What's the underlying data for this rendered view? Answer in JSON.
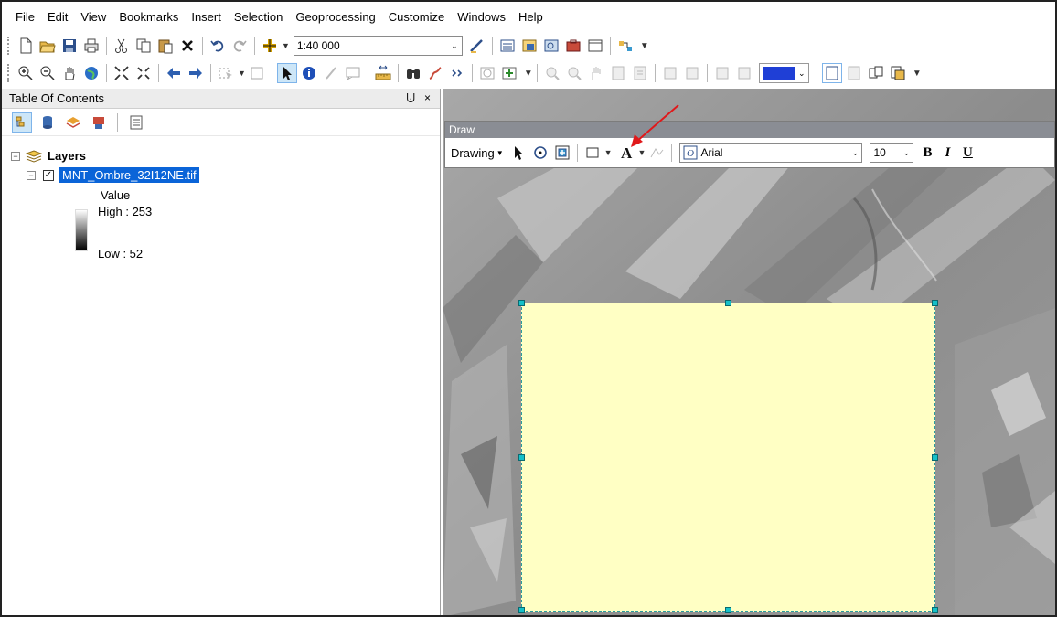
{
  "menu": [
    "File",
    "Edit",
    "View",
    "Bookmarks",
    "Insert",
    "Selection",
    "Geoprocessing",
    "Customize",
    "Windows",
    "Help"
  ],
  "standard_toolbar": {
    "scale_value": "1:40 000",
    "icons": [
      "new-document-icon",
      "open-folder-icon",
      "save-icon",
      "print-icon",
      "cut-icon",
      "copy-icon",
      "paste-icon",
      "delete-icon",
      "undo-icon",
      "redo-icon",
      "add-data-icon"
    ]
  },
  "toc": {
    "title": "Table Of Contents",
    "pin": "⨃",
    "close": "×",
    "layers_label": "Layers",
    "layer_name": "MNT_Ombre_32I12NE.tif",
    "legend_field": "Value",
    "legend_high": "High : 253",
    "legend_low": "Low : 52"
  },
  "draw_toolbar": {
    "title": "Draw",
    "drawing_label": "Drawing",
    "font": "Arial",
    "size": "10",
    "bold": "B",
    "italic": "I",
    "underline": "U"
  },
  "colors": {
    "graphic_fill": "#ffffc4",
    "selection_handle": "#15c0c8",
    "annotation_arrow": "#e0191b",
    "layer_highlight": "#0a64d8"
  }
}
